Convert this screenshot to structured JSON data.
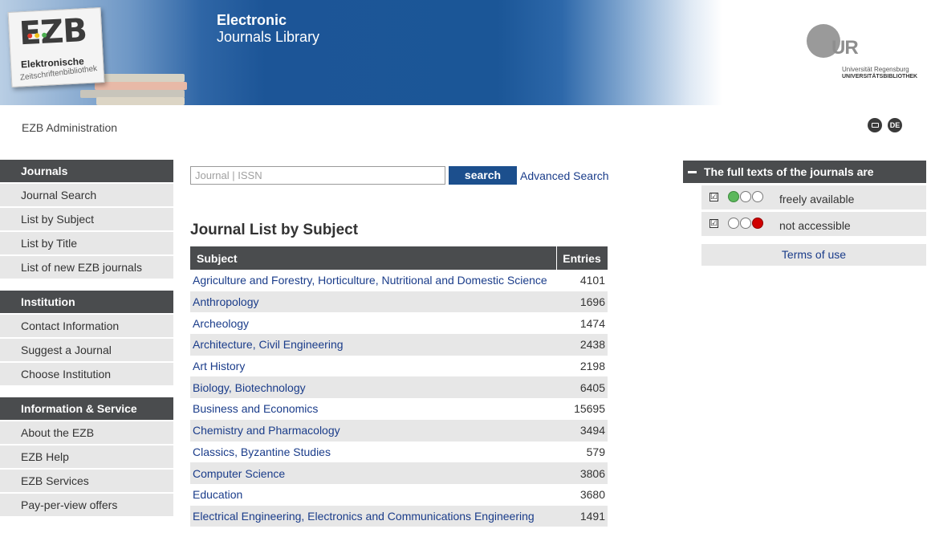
{
  "header": {
    "logo": {
      "mark": "EZB",
      "line1": "Elektronische",
      "line2": "Zeitschriftenbibliothek",
      "dot_colors": [
        "#e03a2b",
        "#f2c21b",
        "#4caf50"
      ]
    },
    "title_line1": "Electronic",
    "title_line2": "Journals Library",
    "partner_logo": {
      "letters": "UR",
      "name": "Universität Regensburg",
      "library": "UNIVERSITÄTSBIBLIOTHEK"
    }
  },
  "admin_link": "EZB Administration",
  "toolbar": {
    "print_icon": "print-icon",
    "language_label": "DE"
  },
  "sidebar": {
    "groups": [
      {
        "heading": "Journals",
        "items": [
          "Journal Search",
          "List by Subject",
          "List by Title",
          "List of new EZB journals"
        ]
      },
      {
        "heading": "Institution",
        "items": [
          "Contact Information",
          "Suggest a Journal",
          "Choose Institution"
        ]
      },
      {
        "heading": "Information & Service",
        "items": [
          "About the EZB",
          "EZB Help",
          "EZB Services",
          "Pay-per-view offers"
        ]
      }
    ]
  },
  "search": {
    "placeholder": "Journal | ISSN",
    "value": "",
    "button_label": "search",
    "advanced_label": "Advanced Search"
  },
  "main": {
    "title": "Journal List by Subject",
    "table": {
      "headers": [
        "Subject",
        "Entries"
      ],
      "rows": [
        {
          "subject": "Agriculture and Forestry, Horticulture, Nutritional and Domestic Science",
          "entries": "4101"
        },
        {
          "subject": "Anthropology",
          "entries": "1696"
        },
        {
          "subject": "Archeology",
          "entries": "1474"
        },
        {
          "subject": "Architecture, Civil Engineering",
          "entries": "2438"
        },
        {
          "subject": "Art History",
          "entries": "2198"
        },
        {
          "subject": "Biology, Biotechnology",
          "entries": "6405"
        },
        {
          "subject": "Business and Economics",
          "entries": "15695"
        },
        {
          "subject": "Chemistry and Pharmacology",
          "entries": "3494"
        },
        {
          "subject": "Classics, Byzantine Studies",
          "entries": "579"
        },
        {
          "subject": "Computer Science",
          "entries": "3806"
        },
        {
          "subject": "Education",
          "entries": "3680"
        },
        {
          "subject": "Electrical Engineering, Electronics and Communications Engineering",
          "entries": "1491"
        }
      ]
    }
  },
  "legend": {
    "heading": "The full texts of the journals are",
    "items": [
      {
        "label": "freely available",
        "checked": true,
        "checkmark": "☑",
        "lights": [
          "green",
          "off",
          "off"
        ]
      },
      {
        "label": "not accessible",
        "checked": true,
        "checkmark": "☑",
        "lights": [
          "off",
          "off",
          "red"
        ]
      }
    ],
    "terms_label": "Terms of use"
  },
  "colors": {
    "header_blue": "#1b5697",
    "nav_dark": "#4a4c4e",
    "row_gray": "#e7e7e7",
    "link_blue": "#1a3c8a",
    "button_blue": "#1c4f8d"
  }
}
